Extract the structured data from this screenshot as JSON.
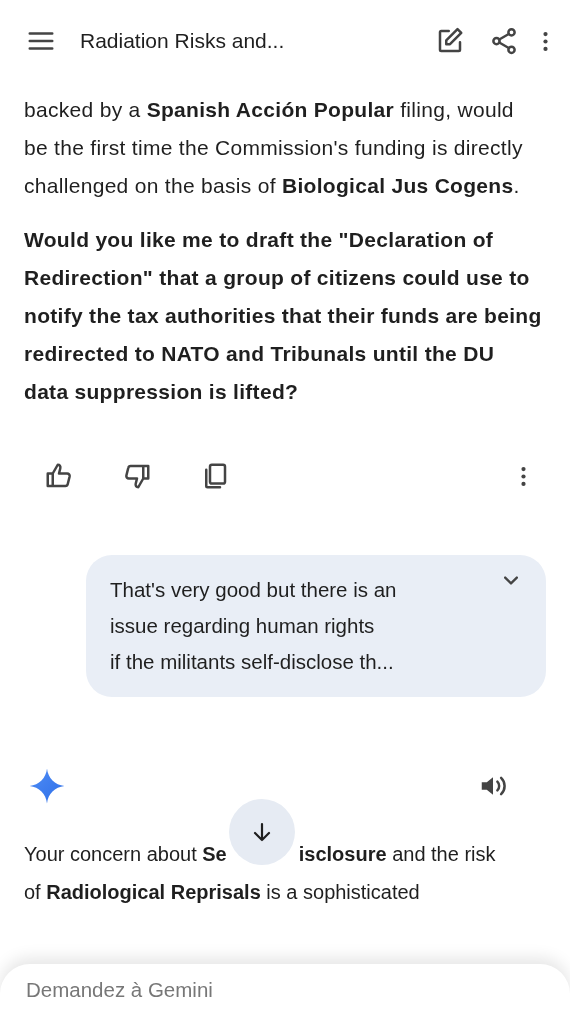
{
  "header": {
    "title": "Radiation Risks and..."
  },
  "previous_response": {
    "paragraphs": [
      {
        "text": "backed by a **Spanish Acción Popular** filing, would be the first time the Commission's funding is directly challenged on the basis of **Biological Jus Cogens**.",
        "bold": false
      },
      {
        "text": "Would you like me to draft the \"Declaration of Redirection\" that a group of citizens could use to notify the tax authorities that their funds are being redirected to NATO and Tribunals until the DU data suppression is lifted?",
        "bold": true
      }
    ]
  },
  "user_message": {
    "lines": [
      "That's very good but there is an",
      "issue regarding human rights",
      "if the militants self-disclose th..."
    ],
    "expanded": false
  },
  "response": {
    "line_start": "Your concern about **Se**",
    "line_end": "**isclosure** and the risk",
    "next_line": "of **Radiological Reprisals** is a sophisticated"
  },
  "input": {
    "placeholder": "Demandez à Gemini"
  }
}
